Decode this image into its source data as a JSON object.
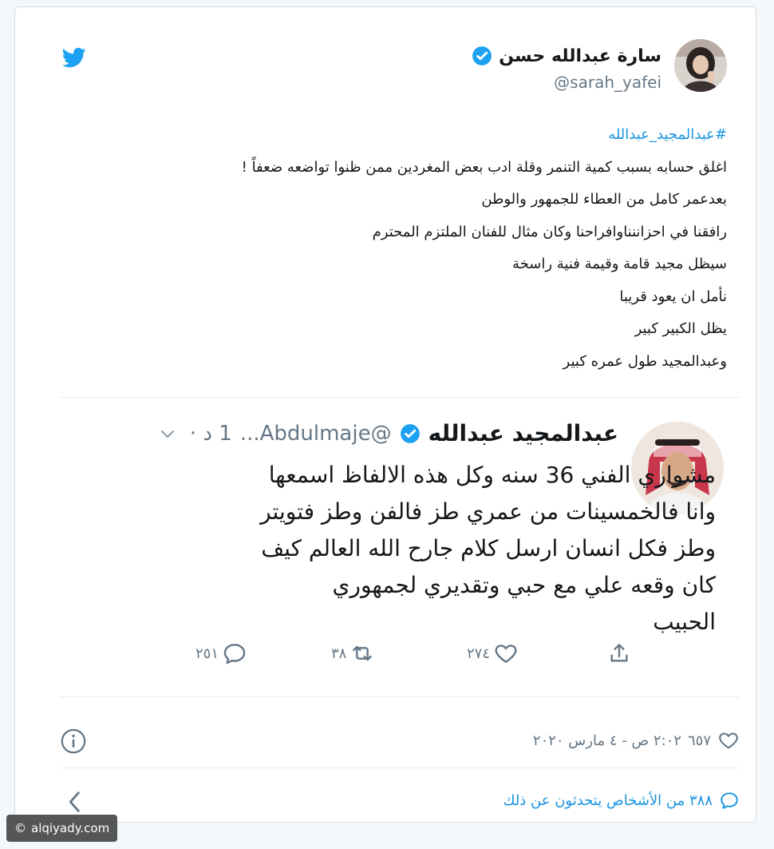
{
  "tweet": {
    "author_name": "سارة عبدالله حسن",
    "author_handle": "@sarah_yafei",
    "hashtag": "#عبدالمجيد_عبدالله",
    "lines": [
      "اغلق حسابه بسبب كمية التنمر وقلة ادب بعض المغردين ممن ظنوا تواضعه ضعفاً !",
      "بعدعمر كامل من العطاء للجمهور والوطن",
      "رافقنا في احزاننناوافراحنا وكان مثال للفنان الملتزم المحترم",
      "سيظل مجيد قامة وقيمة فنية راسخة",
      "نأمل ان يعود قريبا",
      "يظل الكبير كبير",
      "وعبدالمجيد طول عمره كبير"
    ],
    "timestamp": "٢:٠٢ ص - ٤ مارس ٢٠٢٠",
    "likes": "٦٥٧",
    "people_talking": "٣٨٨ من الأشخاص يتحدثون عن ذلك"
  },
  "quoted": {
    "author_name": "عبدالمجيد عبدالله",
    "author_handle": "@Abdulmaje...",
    "time": "1 د ·",
    "text_lines": [
      "مشواري الفني 36 سنه وكل هذه الالفاظ اسمعها",
      "وانا فالخمسينات من عمري طز فالفن وطز فتويتر",
      "وطز فكل انسان ارسل كلام جارح الله العالم كيف",
      "كان وقعه علي مع حبي وتقديري لجمهوري",
      "الحبيب"
    ],
    "replies": "٢٥١",
    "retweets": "٣٨",
    "likes": "٢٧٤"
  },
  "icons": {
    "brand": "twitter-bird-icon",
    "verified": "verified-badge-icon",
    "reply": "reply-icon",
    "retweet": "retweet-icon",
    "like": "heart-icon",
    "share": "share-icon",
    "info": "info-icon",
    "back": "chevron-left-icon",
    "talk": "speech-bubble-icon"
  },
  "colors": {
    "accent": "#1da1f2",
    "link": "#1b95e0",
    "muted": "#657786",
    "text": "#14171a"
  },
  "watermark": "alqiyady.com"
}
